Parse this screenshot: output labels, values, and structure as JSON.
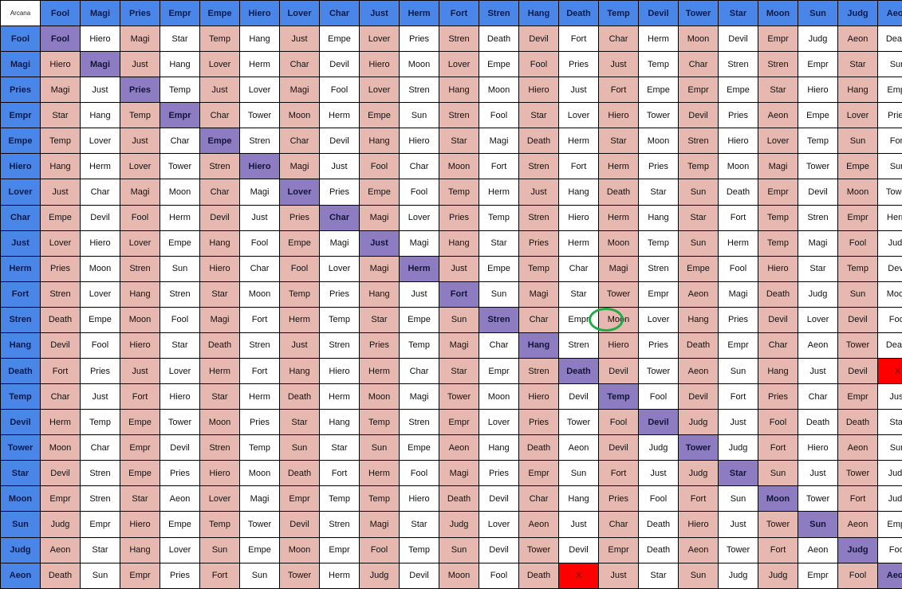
{
  "corner_label": "Arcana",
  "columns": [
    "Fool",
    "Magi",
    "Pries",
    "Empr",
    "Empe",
    "Hiero",
    "Lover",
    "Char",
    "Just",
    "Herm",
    "Fort",
    "Stren",
    "Hang",
    "Death",
    "Temp",
    "Devil",
    "Tower",
    "Star",
    "Moon",
    "Sun",
    "Judg",
    "Aeon"
  ],
  "colors": {
    "header": "#4a86e8",
    "diagonal": "#8e7cc3",
    "even_column": "#e6b8af",
    "odd_column": "#ffffff",
    "invalid": "#ff0000",
    "highlight_circle": "#22aa44"
  },
  "highlight": {
    "row": "Stren",
    "column": "Temp",
    "value": "Moon"
  },
  "rows": [
    {
      "label": "Fool",
      "cells": [
        "Fool",
        "Hiero",
        "Magi",
        "Star",
        "Temp",
        "Hang",
        "Just",
        "Empe",
        "Lover",
        "Pries",
        "Stren",
        "Death",
        "Devil",
        "Fort",
        "Char",
        "Herm",
        "Moon",
        "Devil",
        "Empr",
        "Judg",
        "Aeon",
        "Death"
      ]
    },
    {
      "label": "Magi",
      "cells": [
        "Hiero",
        "Magi",
        "Just",
        "Hang",
        "Lover",
        "Herm",
        "Char",
        "Devil",
        "Hiero",
        "Moon",
        "Lover",
        "Empe",
        "Fool",
        "Pries",
        "Just",
        "Temp",
        "Char",
        "Stren",
        "Stren",
        "Empr",
        "Star",
        "Sun"
      ]
    },
    {
      "label": "Pries",
      "cells": [
        "Magi",
        "Just",
        "Pries",
        "Temp",
        "Just",
        "Lover",
        "Magi",
        "Fool",
        "Lover",
        "Stren",
        "Hang",
        "Moon",
        "Hiero",
        "Just",
        "Fort",
        "Empe",
        "Empr",
        "Empe",
        "Star",
        "Hiero",
        "Hang",
        "Empr"
      ]
    },
    {
      "label": "Empr",
      "cells": [
        "Star",
        "Hang",
        "Temp",
        "Empr",
        "Char",
        "Tower",
        "Moon",
        "Herm",
        "Empe",
        "Sun",
        "Stren",
        "Fool",
        "Star",
        "Lover",
        "Hiero",
        "Tower",
        "Devil",
        "Pries",
        "Aeon",
        "Empe",
        "Lover",
        "Pries"
      ]
    },
    {
      "label": "Empe",
      "cells": [
        "Temp",
        "Lover",
        "Just",
        "Char",
        "Empe",
        "Stren",
        "Char",
        "Devil",
        "Hang",
        "Hiero",
        "Star",
        "Magi",
        "Death",
        "Herm",
        "Star",
        "Moon",
        "Stren",
        "Hiero",
        "Lover",
        "Temp",
        "Sun",
        "Fort"
      ]
    },
    {
      "label": "Hiero",
      "cells": [
        "Hang",
        "Herm",
        "Lover",
        "Tower",
        "Stren",
        "Hiero",
        "Magi",
        "Just",
        "Fool",
        "Char",
        "Moon",
        "Fort",
        "Stren",
        "Fort",
        "Herm",
        "Pries",
        "Temp",
        "Moon",
        "Magi",
        "Tower",
        "Empe",
        "Sun"
      ]
    },
    {
      "label": "Lover",
      "cells": [
        "Just",
        "Char",
        "Magi",
        "Moon",
        "Char",
        "Magi",
        "Lover",
        "Pries",
        "Empe",
        "Fool",
        "Temp",
        "Herm",
        "Just",
        "Hang",
        "Death",
        "Star",
        "Sun",
        "Death",
        "Empr",
        "Devil",
        "Moon",
        "Tower"
      ]
    },
    {
      "label": "Char",
      "cells": [
        "Empe",
        "Devil",
        "Fool",
        "Herm",
        "Devil",
        "Just",
        "Pries",
        "Char",
        "Magi",
        "Lover",
        "Pries",
        "Temp",
        "Stren",
        "Hiero",
        "Herm",
        "Hang",
        "Star",
        "Fort",
        "Temp",
        "Stren",
        "Empr",
        "Herm"
      ]
    },
    {
      "label": "Just",
      "cells": [
        "Lover",
        "Hiero",
        "Lover",
        "Empe",
        "Hang",
        "Fool",
        "Empe",
        "Magi",
        "Just",
        "Magi",
        "Hang",
        "Star",
        "Pries",
        "Herm",
        "Moon",
        "Temp",
        "Sun",
        "Herm",
        "Temp",
        "Magi",
        "Fool",
        "Judg"
      ]
    },
    {
      "label": "Herm",
      "cells": [
        "Pries",
        "Moon",
        "Stren",
        "Sun",
        "Hiero",
        "Char",
        "Fool",
        "Lover",
        "Magi",
        "Herm",
        "Just",
        "Empe",
        "Temp",
        "Char",
        "Magi",
        "Stren",
        "Empe",
        "Fool",
        "Hiero",
        "Star",
        "Temp",
        "Devil"
      ]
    },
    {
      "label": "Fort",
      "cells": [
        "Stren",
        "Lover",
        "Hang",
        "Stren",
        "Star",
        "Moon",
        "Temp",
        "Pries",
        "Hang",
        "Just",
        "Fort",
        "Sun",
        "Magi",
        "Star",
        "Tower",
        "Empr",
        "Aeon",
        "Magi",
        "Death",
        "Judg",
        "Sun",
        "Moon"
      ]
    },
    {
      "label": "Stren",
      "cells": [
        "Death",
        "Empe",
        "Moon",
        "Fool",
        "Magi",
        "Fort",
        "Herm",
        "Temp",
        "Star",
        "Empe",
        "Sun",
        "Stren",
        "Char",
        "Empr",
        "Moon",
        "Lover",
        "Hang",
        "Pries",
        "Devil",
        "Lover",
        "Devil",
        "Fool"
      ]
    },
    {
      "label": "Hang",
      "cells": [
        "Devil",
        "Fool",
        "Hiero",
        "Star",
        "Death",
        "Stren",
        "Just",
        "Stren",
        "Pries",
        "Temp",
        "Magi",
        "Char",
        "Hang",
        "Stren",
        "Hiero",
        "Pries",
        "Death",
        "Empr",
        "Char",
        "Aeon",
        "Tower",
        "Death"
      ]
    },
    {
      "label": "Death",
      "cells": [
        "Fort",
        "Pries",
        "Just",
        "Lover",
        "Herm",
        "Fort",
        "Hang",
        "Hiero",
        "Herm",
        "Char",
        "Star",
        "Empr",
        "Stren",
        "Death",
        "Devil",
        "Tower",
        "Aeon",
        "Sun",
        "Hang",
        "Just",
        "Devil",
        "X"
      ]
    },
    {
      "label": "Temp",
      "cells": [
        "Char",
        "Just",
        "Fort",
        "Hiero",
        "Star",
        "Herm",
        "Death",
        "Herm",
        "Moon",
        "Magi",
        "Tower",
        "Moon",
        "Hiero",
        "Devil",
        "Temp",
        "Fool",
        "Devil",
        "Fort",
        "Pries",
        "Char",
        "Empr",
        "Just"
      ]
    },
    {
      "label": "Devil",
      "cells": [
        "Herm",
        "Temp",
        "Empe",
        "Tower",
        "Moon",
        "Pries",
        "Star",
        "Hang",
        "Temp",
        "Stren",
        "Empr",
        "Lover",
        "Pries",
        "Tower",
        "Fool",
        "Devil",
        "Judg",
        "Just",
        "Fool",
        "Death",
        "Death",
        "Star"
      ]
    },
    {
      "label": "Tower",
      "cells": [
        "Moon",
        "Char",
        "Empr",
        "Devil",
        "Stren",
        "Temp",
        "Sun",
        "Star",
        "Sun",
        "Empe",
        "Aeon",
        "Hang",
        "Death",
        "Aeon",
        "Devil",
        "Judg",
        "Tower",
        "Judg",
        "Fort",
        "Hiero",
        "Aeon",
        "Sun"
      ]
    },
    {
      "label": "Star",
      "cells": [
        "Devil",
        "Stren",
        "Empe",
        "Pries",
        "Hiero",
        "Moon",
        "Death",
        "Fort",
        "Herm",
        "Fool",
        "Magi",
        "Pries",
        "Empr",
        "Sun",
        "Fort",
        "Just",
        "Judg",
        "Star",
        "Sun",
        "Just",
        "Tower",
        "Judg"
      ]
    },
    {
      "label": "Moon",
      "cells": [
        "Empr",
        "Stren",
        "Star",
        "Aeon",
        "Lover",
        "Magi",
        "Empr",
        "Temp",
        "Temp",
        "Hiero",
        "Death",
        "Devil",
        "Char",
        "Hang",
        "Pries",
        "Fool",
        "Fort",
        "Sun",
        "Moon",
        "Tower",
        "Fort",
        "Judg"
      ]
    },
    {
      "label": "Sun",
      "cells": [
        "Judg",
        "Empr",
        "Hiero",
        "Empe",
        "Temp",
        "Tower",
        "Devil",
        "Stren",
        "Magi",
        "Star",
        "Judg",
        "Lover",
        "Aeon",
        "Just",
        "Char",
        "Death",
        "Hiero",
        "Just",
        "Tower",
        "Sun",
        "Aeon",
        "Empr"
      ]
    },
    {
      "label": "Judg",
      "cells": [
        "Aeon",
        "Star",
        "Hang",
        "Lover",
        "Sun",
        "Empe",
        "Moon",
        "Empr",
        "Fool",
        "Temp",
        "Sun",
        "Devil",
        "Tower",
        "Devil",
        "Empr",
        "Death",
        "Aeon",
        "Tower",
        "Fort",
        "Aeon",
        "Judg",
        "Fool"
      ]
    },
    {
      "label": "Aeon",
      "cells": [
        "Death",
        "Sun",
        "Empr",
        "Pries",
        "Fort",
        "Sun",
        "Tower",
        "Herm",
        "Judg",
        "Devil",
        "Moon",
        "Fool",
        "Death",
        "X",
        "Just",
        "Star",
        "Sun",
        "Judg",
        "Judg",
        "Empr",
        "Fool",
        "Aeon"
      ]
    }
  ]
}
